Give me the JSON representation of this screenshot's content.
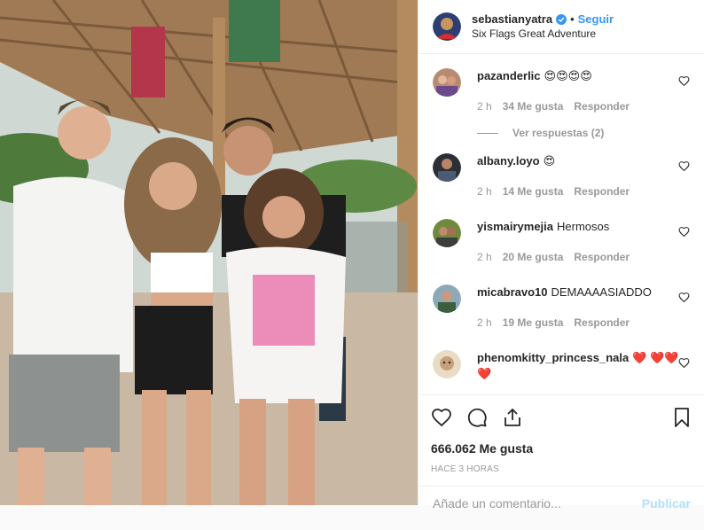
{
  "header": {
    "username": "sebastianyatra",
    "separator": "•",
    "follow_label": "Seguir",
    "location": "Six Flags Great Adventure"
  },
  "comments": [
    {
      "username": "pazanderlic",
      "text": "😍😍😍😍",
      "time": "2 h",
      "likes": "34 Me gusta",
      "reply": "Responder",
      "view_replies": "Ver respuestas (2)"
    },
    {
      "username": "albany.loyo",
      "text": "😍",
      "time": "2 h",
      "likes": "14 Me gusta",
      "reply": "Responder"
    },
    {
      "username": "yismairymejia",
      "text": "Hermosos",
      "time": "2 h",
      "likes": "20 Me gusta",
      "reply": "Responder"
    },
    {
      "username": "micabravo10",
      "text": "DEMAAAASIADDO",
      "time": "2 h",
      "likes": "19 Me gusta",
      "reply": "Responder"
    },
    {
      "username": "phenomkitty_princess_nala",
      "text": "❤️ ❤️❤️❤️"
    }
  ],
  "actions": {
    "likes_count": "666.062 Me gusta",
    "timestamp": "HACE 3 HORAS"
  },
  "add_comment": {
    "placeholder": "Añade un comentario...",
    "publish_label": "Publicar"
  },
  "colors": {
    "accent": "#3897f0",
    "text": "#262626",
    "muted": "#999999",
    "heart": "#ed4956"
  },
  "icons": [
    "verified-badge-icon",
    "heart-icon",
    "comment-icon",
    "share-icon",
    "bookmark-icon"
  ]
}
